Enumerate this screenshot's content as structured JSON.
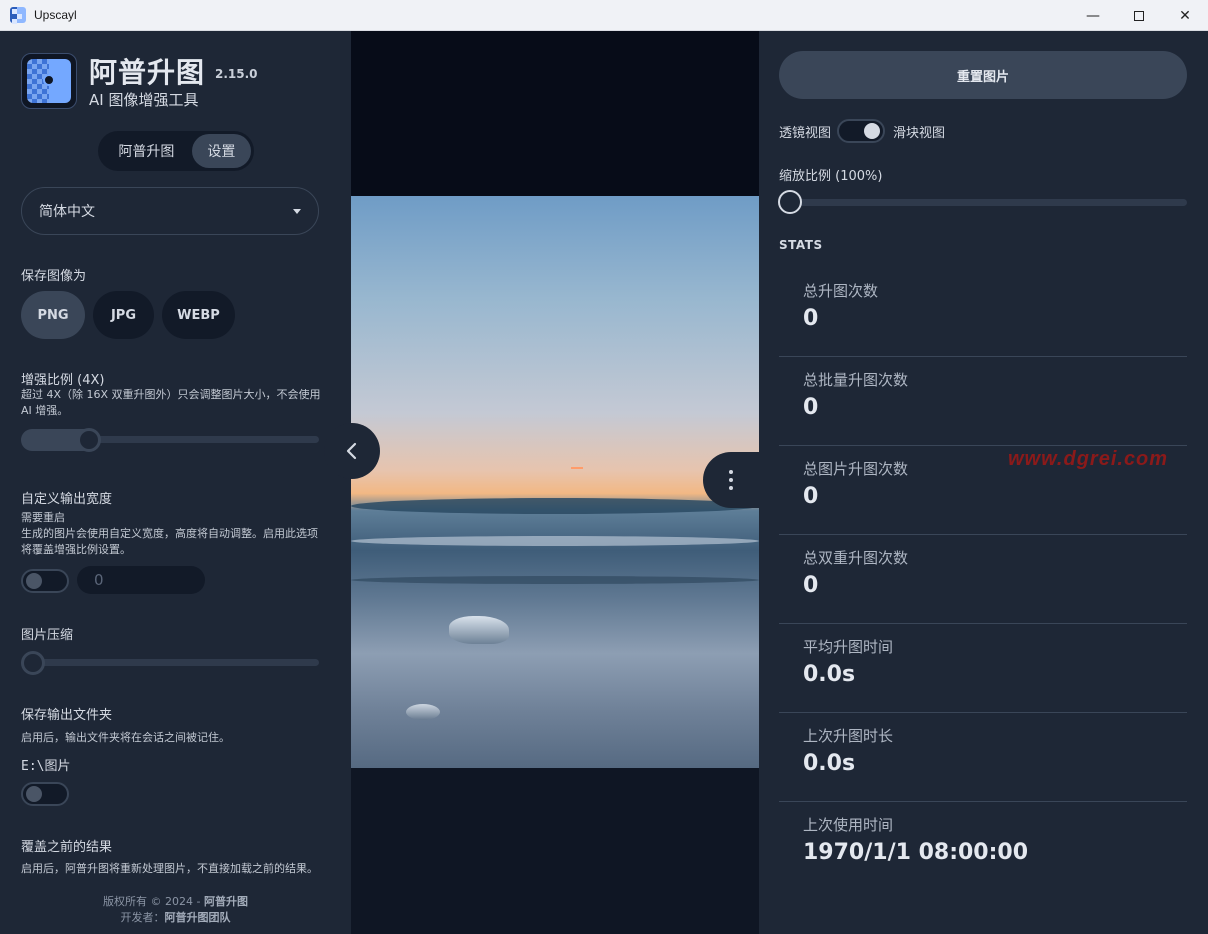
{
  "window": {
    "title": "Upscayl",
    "minimize": "—",
    "close": "✕"
  },
  "brand": {
    "name": "阿普升图",
    "version": "2.15.0",
    "subtitle": "AI 图像增强工具"
  },
  "tabs": [
    {
      "label": "阿普升图",
      "active": false
    },
    {
      "label": "设置",
      "active": true
    }
  ],
  "language": {
    "selected": "简体中文"
  },
  "save_format": {
    "title": "保存图像为",
    "options": [
      "PNG",
      "JPG",
      "WEBP"
    ],
    "selected": "PNG"
  },
  "scale": {
    "title": "增强比例 (4X)",
    "description": "超过 4X（除 16X 双重升图外）只会调整图片大小，不会使用 AI 增强。",
    "value": 4
  },
  "custom_width": {
    "title": "自定义输出宽度",
    "note": "需要重启",
    "description": "生成的图片会使用自定义宽度，高度将自动调整。启用此选项将覆盖增强比例设置。",
    "enabled": false,
    "value": "0"
  },
  "compression": {
    "title": "图片压缩",
    "value": 0
  },
  "save_folder": {
    "title": "保存输出文件夹",
    "description": "启用后，输出文件夹将在会话之间被记住。",
    "path": "E:\\图片",
    "enabled": false
  },
  "overwrite": {
    "title": "覆盖之前的结果",
    "description": "启用后，阿普升图将重新处理图片，不直接加载之前的结果。"
  },
  "footer": {
    "copyright_prefix": "版权所有 © 2024 - ",
    "copyright_name": "阿普升图",
    "dev_prefix": "开发者：",
    "dev_name": "阿普升图团队"
  },
  "right_panel": {
    "reset_label": "重置图片",
    "lens_view": "透镜视图",
    "slider_view": "滑块视图",
    "zoom_label": "缩放比例 (100%)",
    "stats_title": "STATS",
    "stats": [
      {
        "label": "总升图次数",
        "value": "0"
      },
      {
        "label": "总批量升图次数",
        "value": "0"
      },
      {
        "label": "总图片升图次数",
        "value": "0"
      },
      {
        "label": "总双重升图次数",
        "value": "0"
      },
      {
        "label": "平均升图时间",
        "value": "0.0s"
      },
      {
        "label": "上次升图时长",
        "value": "0.0s"
      },
      {
        "label": "上次使用时间",
        "value": "1970/1/1 08:00:00"
      }
    ]
  },
  "watermark": "www.dgrei.com"
}
